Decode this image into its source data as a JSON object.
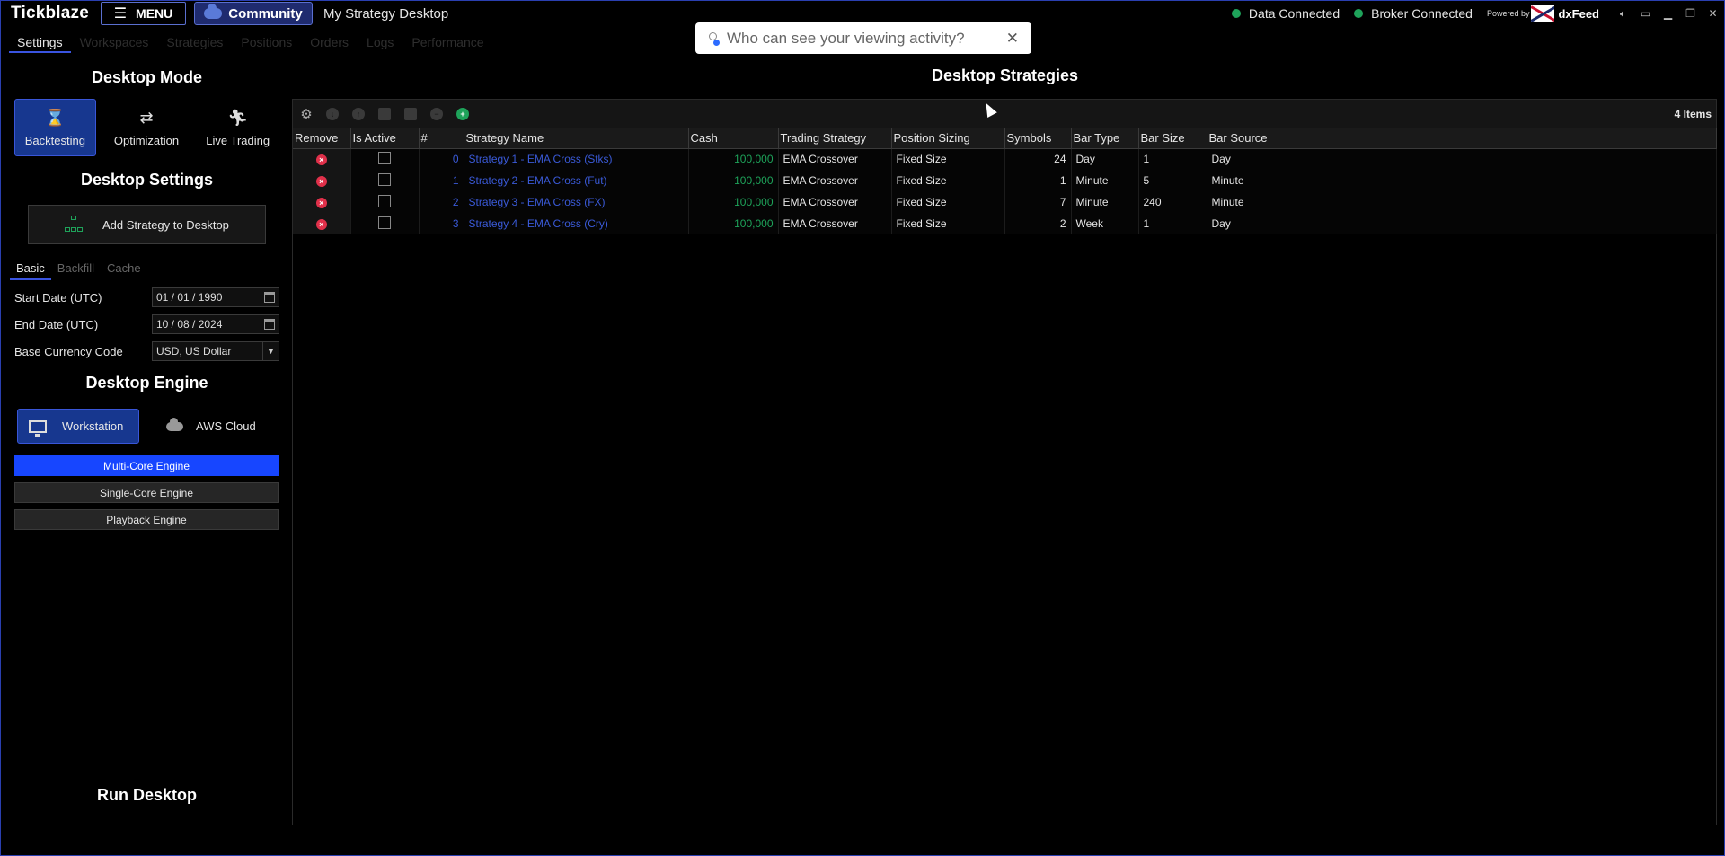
{
  "titlebar": {
    "brand": "Tickblaze",
    "menu_label": "MENU",
    "community_label": "Community",
    "desktop_title": "My Strategy Desktop",
    "data_status": "Data Connected",
    "broker_status": "Broker Connected",
    "powered_by": "Powered by",
    "feed_name": "dxFeed",
    "status_color": "#1ea35a"
  },
  "toast": {
    "text": "Who can see your viewing activity?"
  },
  "navtabs": [
    "Settings",
    "Workspaces",
    "Strategies",
    "Positions",
    "Orders",
    "Logs",
    "Performance"
  ],
  "left": {
    "desktop_mode_title": "Desktop Mode",
    "modes": [
      {
        "label": "Backtesting",
        "icon": "hourglass-icon"
      },
      {
        "label": "Optimization",
        "icon": "swap-arrows-icon"
      },
      {
        "label": "Live Trading",
        "icon": "runner-icon"
      }
    ],
    "desktop_settings_title": "Desktop Settings",
    "add_strategy_label": "Add Strategy to Desktop",
    "subtabs": [
      "Basic",
      "Backfill",
      "Cache"
    ],
    "start_date_label": "Start Date (UTC)",
    "start_date_value": "01 / 01 / 1990",
    "end_date_label": "End Date (UTC)",
    "end_date_value": "10 / 08 / 2024",
    "currency_label": "Base Currency Code",
    "currency_value": "USD, US Dollar",
    "desktop_engine_title": "Desktop Engine",
    "workstation_label": "Workstation",
    "aws_label": "AWS Cloud",
    "engines": [
      "Multi-Core Engine",
      "Single-Core Engine",
      "Playback Engine"
    ],
    "run_title": "Run Desktop"
  },
  "right": {
    "title": "Desktop Strategies",
    "items_count": "4 Items",
    "columns": [
      "Remove",
      "Is Active",
      "#",
      "Strategy Name",
      "Cash",
      "Trading Strategy",
      "Position Sizing",
      "Symbols",
      "Bar Type",
      "Bar Size",
      "Bar Source"
    ],
    "rows": [
      {
        "num": "0",
        "name": "Strategy 1 - EMA Cross (Stks)",
        "cash": "100,000",
        "trading": "EMA Crossover",
        "sizing": "Fixed Size",
        "symbols": "24",
        "bar_type": "Day",
        "bar_size": "1",
        "bar_source": "Day"
      },
      {
        "num": "1",
        "name": "Strategy 2 - EMA Cross (Fut)",
        "cash": "100,000",
        "trading": "EMA Crossover",
        "sizing": "Fixed Size",
        "symbols": "1",
        "bar_type": "Minute",
        "bar_size": "5",
        "bar_source": "Minute"
      },
      {
        "num": "2",
        "name": "Strategy 3 - EMA Cross (FX)",
        "cash": "100,000",
        "trading": "EMA Crossover",
        "sizing": "Fixed Size",
        "symbols": "7",
        "bar_type": "Minute",
        "bar_size": "240",
        "bar_source": "Minute"
      },
      {
        "num": "3",
        "name": "Strategy 4 - EMA Cross (Cry)",
        "cash": "100,000",
        "trading": "EMA Crossover",
        "sizing": "Fixed Size",
        "symbols": "2",
        "bar_type": "Week",
        "bar_size": "1",
        "bar_source": "Day"
      }
    ]
  }
}
